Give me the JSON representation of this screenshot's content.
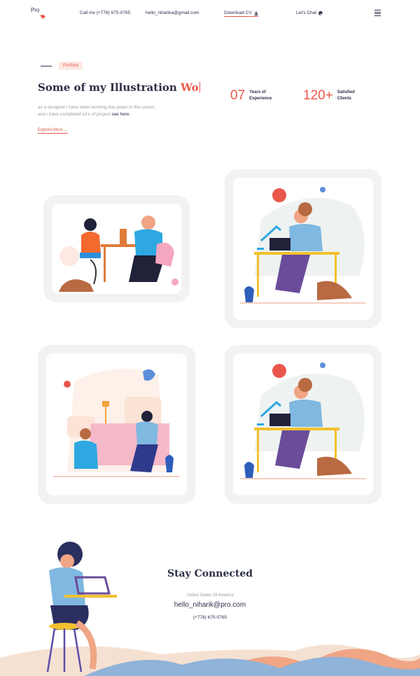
{
  "header": {
    "logo_text": "Pro",
    "call": "Call me (+778) 675-0765",
    "email": "hello_niharika@gmail.com",
    "download_cv": "Download CV",
    "lets_chat": "Let's Chat"
  },
  "hero": {
    "eyebrow": "Portfolio",
    "title_main": "Some of my Illustration",
    "title_accent": "Wo",
    "desc_line1": "as a designer i have been working few years in this sector,",
    "desc_line2": "and i have completed lot's of project",
    "desc_link": "see here.",
    "explore": "Explore More"
  },
  "stats": [
    {
      "number": "07",
      "label_line1": "Years of",
      "label_line2": "Experience"
    },
    {
      "number": "120+",
      "label_line1": "Satisfied",
      "label_line2": "Clients"
    }
  ],
  "footer": {
    "title": "Stay Connected",
    "country": "United States Of America",
    "email": "hello_niharik@pro.com",
    "phone": "(+778) 675-0765"
  },
  "colors": {
    "accent": "#e8574a",
    "text": "#2c2f4a",
    "muted": "#9a9cab",
    "card_bg": "#f2f2f2"
  }
}
